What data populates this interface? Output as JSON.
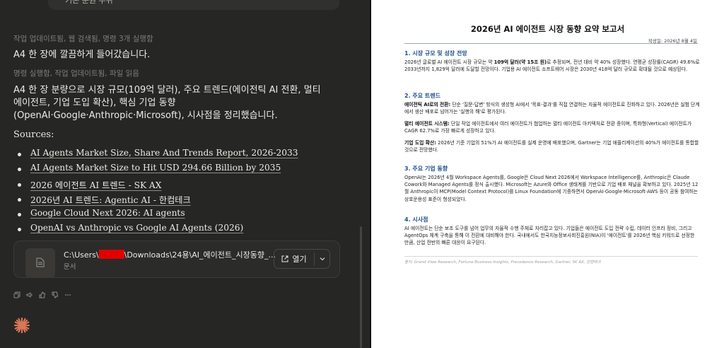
{
  "chat": {
    "prev_input_text": "기본 분원 우위",
    "status_1": "작업 업데이트됨, 웹 검색됨, 명령 3개 실행함",
    "message_1": "A4 한 장에 깔끔하게 들어갔습니다.",
    "status_2": "명령 실행함, 작업 업데이트됨, 파일 읽음",
    "message_2": "A4 한 장 분량으로 시장 규모(109억 달러), 주요 트렌드(에이전틱 AI 전환, 멀티 에이전트, 기업 도입 확산), 핵심 기업 동향(OpenAI·Google·Anthropic·Microsoft), 시사점을 정리했습니다.",
    "sources_label": "Sources:",
    "sources": [
      "AI Agents Market Size, Share And Trends Report, 2026-2033",
      "AI Agents Market Size to Hit USD 294.66 Billion by 2035",
      "2026 에이전트 AI 트렌드 - SK AX",
      "2026년 AI 트렌드: Agentic AI - 한컴테크",
      "Google Cloud Next 2026: AI agents",
      "OpenAI vs Anthropic vs Google AI Agents (2026)"
    ],
    "file": {
      "path_prefix": "C:\\Users\\",
      "path_suffix": "\\Downloads\\24용\\AI_에이전트_시장동향_...",
      "type": "문서",
      "open_label": "열기"
    },
    "icons": [
      "copy-icon",
      "speaker-icon",
      "thumbs-up-icon",
      "thumbs-down-icon",
      "more-icon"
    ],
    "accent": "#d97757"
  },
  "doc": {
    "title": "2026년 AI 에이전트 시장 동향 요약 보고서",
    "date": "작성일: 2026년 8월 4일",
    "s1": {
      "heading": "1. 시장 규모 및 성장 전망",
      "t1": "2026년 글로벌 AI 에이전트 시장 규모는 약 ",
      "b1": "109억 달러(약 15조 원)",
      "t2": "로 추정되며, 전년 대비 약 40% 성장했다. 연평균 성장률(CAGR) 49.6%로 2033년까지 1,829억 달러에 도달할 전망이다. 기업용 AI 에이전트 소프트웨어 시장은 2030년 418억 달러 규모로 확대될 것으로 예상된다."
    },
    "s2": {
      "heading": "2. 주요 트렌드",
      "b1": "에이전틱 AI로의 전환:",
      "t1": " 단순 '질문-답변' 방식의 생성형 AI에서 '목표-결과'를 직접 연결하는 자율적 에이전트로 진화하고 있다. 2026년은 실험 단계에서 생산 배포로 넘어가는 '실행의 해'로 평가된다.",
      "b2": "멀티 에이전트 시스템:",
      "t2": " 단일 작업 에이전트에서 여러 에이전트가 협업하는 멀티 에이전트 아키텍처로 전환 중이며, 특화형(Vertical) 에이전트가 CAGR 62.7%로 가장 빠르게 성장하고 있다.",
      "b3": "기업 도입 확산:",
      "t3": " 2026년 기준 기업의 51%가 AI 에이전트를 실제 운영에 배포했으며, Gartner는 기업 애플리케이션의 40%가 에이전트를 통합할 것으로 전망했다."
    },
    "s3": {
      "heading": "3. 주요 기업 동향",
      "text": "OpenAI는 2026년 4월 Workspace Agents를, Google은 Cloud Next 2026에서 Workspace Intelligence를, Anthropic은 Claude Cowork와 Managed Agents를 정식 출시했다. Microsoft는 Azure와 Office 생태계를 기반으로 기업 배포 채널을 확보하고 있다. 2025년 12월 Anthropic이 MCP(Model Context Protocol)를 Linux Foundation에 기증하면서 OpenAI·Google·Microsoft·AWS 등이 공동 참여하는 상호운용성 표준이 형성되었다."
    },
    "s4": {
      "heading": "4. 시사점",
      "text": "AI 에이전트는 단순 보조 도구를 넘어 업무의 자율적 수행 주체로 자리잡고 있다. 기업들은 에이전트 도입 전략 수립, 데이터 인프라 정비, 그리고 AgentOps 체계 구축을 통해 이 전환에 대비해야 한다. 국내에서도 한국지능정보사회진흥원(NIA)이 '에이전트'를 2026년 핵심 키워드로 선정한 만큼, 산업 전반의 빠른 대응이 요구된다."
    },
    "footer": "출처: Grand View Research, Fortune Business Insights, Precedence Research, Gartner, SK AX, 한컴테크",
    "heading_color": "#1f4e8c"
  }
}
